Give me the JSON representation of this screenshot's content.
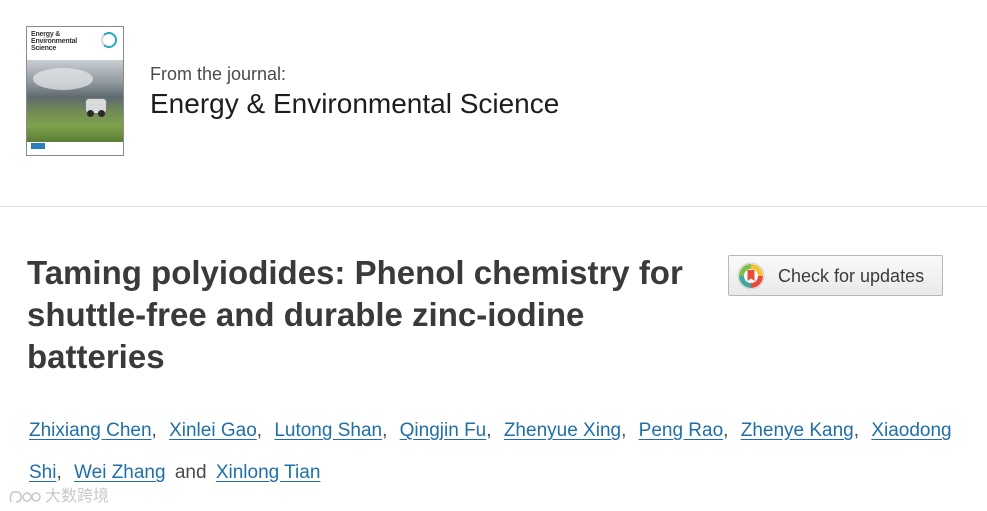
{
  "journal": {
    "cover_title": "Energy &\nEnvironmental\nScience",
    "from_label": "From the journal:",
    "name": "Energy & Environmental Science"
  },
  "article": {
    "title": "Taming polyiodides: Phenol chemistry for shuttle-free and durable zinc-iodine batteries"
  },
  "check_updates": {
    "label": "Check for updates",
    "icon": "crossmark-icon"
  },
  "authors": {
    "names": [
      "Zhixiang Chen",
      "Xinlei Gao",
      "Lutong Shan",
      "Qingjin Fu",
      "Zhenyue Xing",
      "Peng Rao",
      "Zhenye Kang",
      "Xiaodong Shi",
      "Wei Zhang",
      "Xinlong Tian"
    ],
    "separator": ",",
    "conjunction": "and"
  },
  "watermark": {
    "text": "大数跨境",
    "icon": "logo-icon"
  },
  "colors": {
    "link": "#1f6fa8",
    "title": "#3a3a3a",
    "divider": "#e3e3e3"
  }
}
